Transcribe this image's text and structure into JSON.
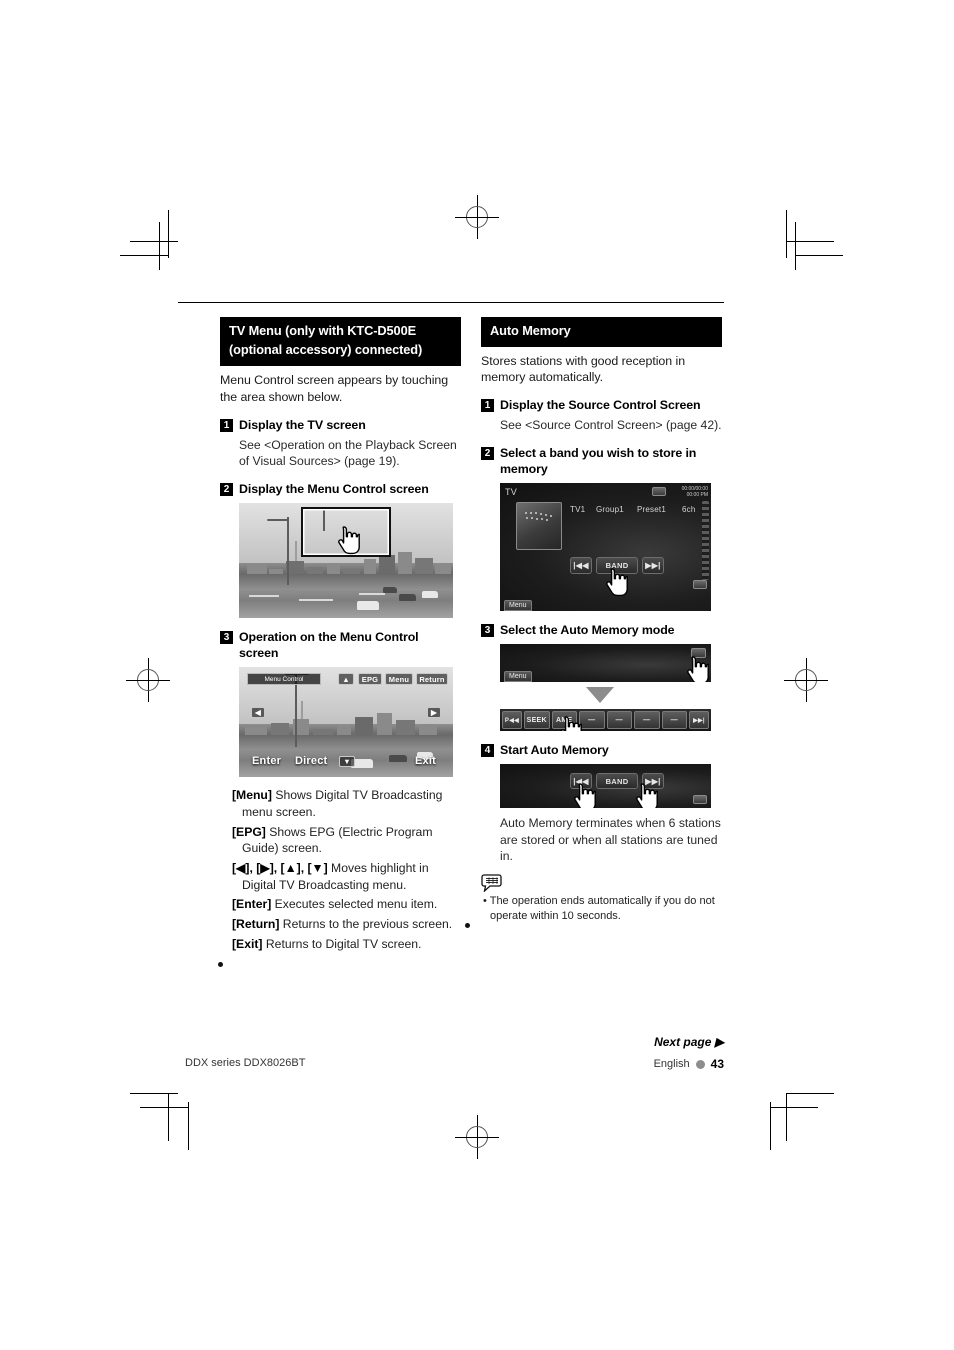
{
  "page": {
    "rule_top": true,
    "footer": {
      "next_page": "Next page ▶",
      "model": "DDX series   DDX8026BT",
      "language": "English",
      "page_number": "43"
    }
  },
  "left_column": {
    "section_title_line1": "TV Menu (only with KTC-D500E",
    "section_title_line2": "(optional accessory) connected)",
    "intro": "Menu Control screen appears by touching the area shown below.",
    "steps": [
      {
        "num": "1",
        "title": "Display the TV screen",
        "sub": "See <Operation on the Playback Screen of Visual Sources> (page 19)."
      },
      {
        "num": "2",
        "title": "Display the Menu Control screen"
      },
      {
        "num": "3",
        "title_line1": "Operation on the Menu Control",
        "title_line2": "screen"
      }
    ],
    "menu_control_screen": {
      "title_bar": "Menu Control",
      "top_buttons": [
        "▲",
        "EPG",
        "Menu",
        "Return"
      ],
      "left_button": "◀",
      "right_button": "▶",
      "bottom_buttons": [
        "Enter",
        "Direct",
        "▼"
      ],
      "exit_button": "Exit"
    },
    "definitions": [
      {
        "key": "[Menu]",
        "text": "Shows Digital TV Broadcasting menu screen."
      },
      {
        "key": "[EPG]",
        "text": "Shows EPG (Electric Program Guide) screen."
      },
      {
        "key": "[◀], [▶], [▲], [▼]",
        "text": "Moves highlight in Digital TV Broadcasting menu."
      },
      {
        "key": "[Enter]",
        "text": "Executes selected menu item."
      },
      {
        "key": "[Return]",
        "text": "Returns to the previous screen."
      },
      {
        "key": "[Exit]",
        "text": "Returns to Digital TV screen."
      }
    ]
  },
  "right_column": {
    "section_title": "Auto Memory",
    "intro": "Stores stations with good reception in memory automatically.",
    "steps": [
      {
        "num": "1",
        "title": "Display the Source Control Screen",
        "sub": "See <Source Control Screen> (page 42)."
      },
      {
        "num": "2",
        "title_line1": "Select a band you wish to store in",
        "title_line2": "memory"
      },
      {
        "num": "3",
        "title": "Select the Auto Memory mode"
      },
      {
        "num": "4",
        "title": "Start Auto Memory"
      }
    ],
    "tv_source_screen": {
      "source_label": "TV",
      "info_fields": [
        "TV1",
        "Group1",
        "Preset1",
        "6ch"
      ],
      "time_elapsed": "00:00/00:00",
      "clock": "00:00 PM",
      "transport_buttons": [
        "|◀◀",
        "BAND",
        "▶▶|"
      ],
      "menu_tab": "Menu"
    },
    "mode_bar": {
      "menu_tab": "Menu"
    },
    "function_strip": {
      "buttons": [
        "P◀◀",
        "SEEK",
        "AME",
        "—",
        "—",
        "—",
        "—",
        "▶▶|"
      ]
    },
    "band_bar": {
      "buttons": [
        "|◀◀",
        "BAND",
        "▶▶|"
      ]
    },
    "after_text": "Auto Memory terminates when 6 stations are stored or when all stations are tuned in.",
    "note": "The operation ends automatically if you do not operate within 10 seconds."
  }
}
